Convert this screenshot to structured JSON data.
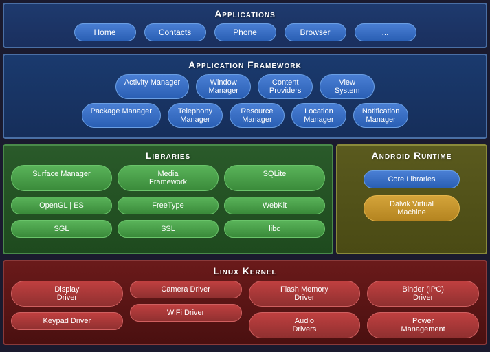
{
  "applications": {
    "title": "Applications",
    "buttons": [
      "Home",
      "Contacts",
      "Phone",
      "Browser",
      "..."
    ]
  },
  "framework": {
    "title": "Application Framework",
    "row1": [
      "Activity Manager",
      "Window\nManager",
      "Content\nProviders",
      "View\nSystem"
    ],
    "row2": [
      "Package Manager",
      "Telephony\nManager",
      "Resource\nManager",
      "Location\nManager",
      "Notification\nManager"
    ]
  },
  "libraries": {
    "title": "Libraries",
    "items": [
      "Surface Manager",
      "Media\nFramework",
      "SQLite",
      "OpenGL | ES",
      "FreeType",
      "WebKit",
      "SGL",
      "SSL",
      "libc"
    ]
  },
  "android_runtime": {
    "title": "Android Runtime",
    "core": "Core Libraries",
    "dalvik": "Dalvik Virtual\nMachine"
  },
  "kernel": {
    "title": "Linux Kernel",
    "col1": [
      "Display\nDriver",
      "Keypad Driver"
    ],
    "col2": [
      "Camera Driver",
      "WiFi Driver"
    ],
    "col3": [
      "Flash Memory\nDriver",
      "Audio\nDrivers"
    ],
    "col4": [
      "Binder (IPC)\nDriver",
      "Power\nManagement"
    ]
  }
}
